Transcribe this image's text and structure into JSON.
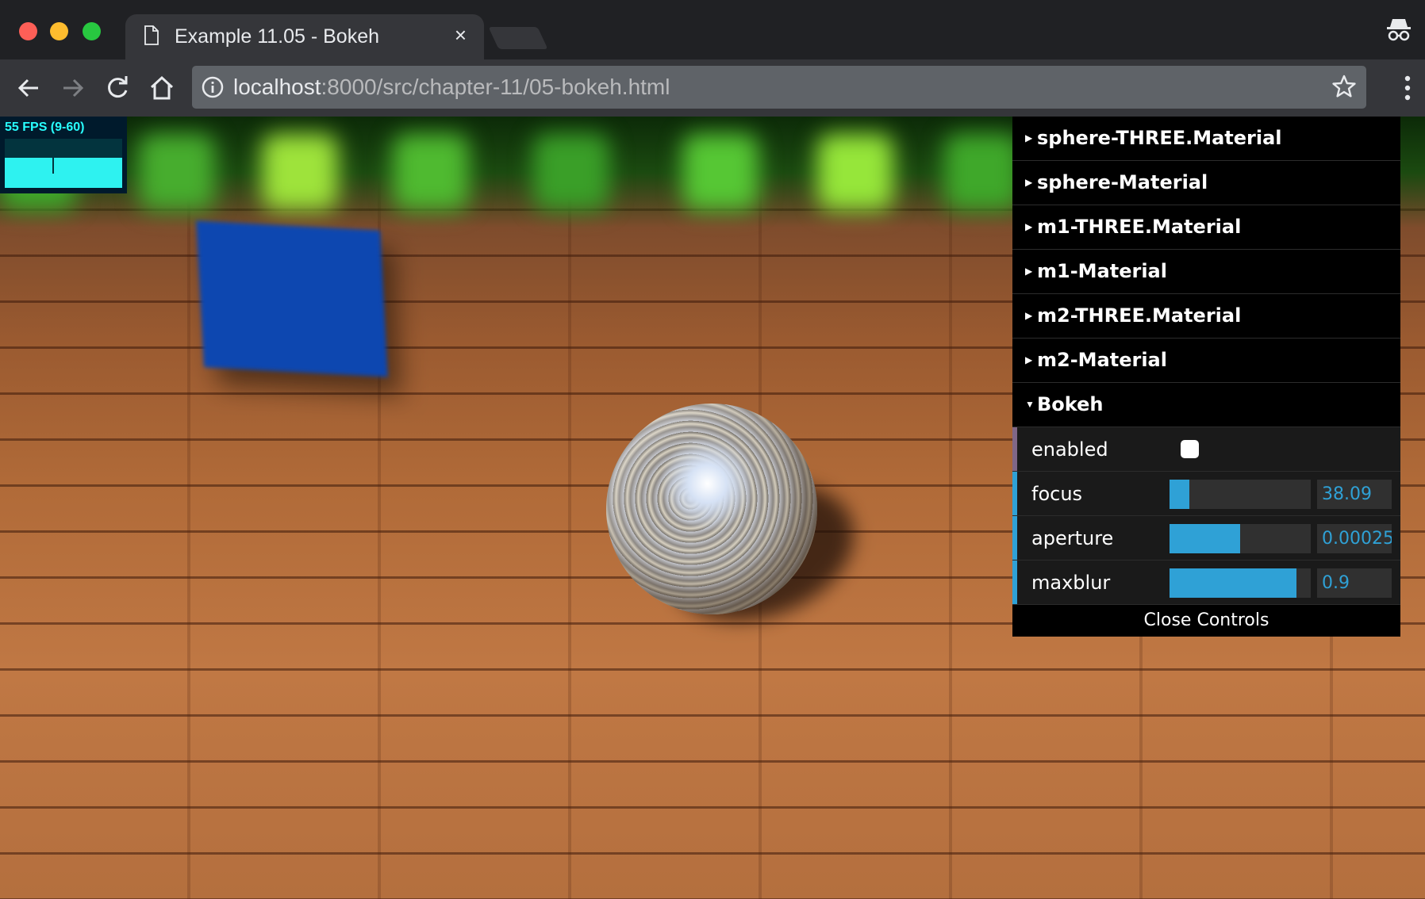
{
  "browser": {
    "tab_title": "Example 11.05 - Bokeh",
    "tab_close": "×",
    "url_host": "localhost",
    "url_path": ":8000/src/chapter-11/05-bokeh.html",
    "icons": [
      "page-icon",
      "close-icon",
      "incognito-icon",
      "back-icon",
      "forward-icon",
      "reload-icon",
      "home-icon",
      "info-icon",
      "star-icon",
      "menu-icon"
    ]
  },
  "stats": {
    "label": "55 FPS (9-60)",
    "fps": 55,
    "min": 9,
    "max": 60,
    "colors": {
      "text": "#28ffff",
      "bar": "#2ef2f0"
    }
  },
  "gui": {
    "folders": [
      {
        "label": "sphere-THREE.Material"
      },
      {
        "label": "sphere-Material"
      },
      {
        "label": "m1-THREE.Material"
      },
      {
        "label": "m1-Material"
      },
      {
        "label": "m2-THREE.Material"
      },
      {
        "label": "m2-Material"
      }
    ],
    "open_folder": {
      "label": "Bokeh"
    },
    "controls": {
      "enabled": {
        "label": "enabled",
        "checked": false
      },
      "focus": {
        "label": "focus",
        "value": "38.09",
        "fraction": 0.14
      },
      "aperture": {
        "label": "aperture",
        "value": "0.00025",
        "fraction": 0.5
      },
      "maxblur": {
        "label": "maxblur",
        "value": "0.9",
        "fraction": 0.9
      }
    },
    "close_label": "Close Controls",
    "colors": {
      "slider_fill": "#2fa1d6",
      "boolean_accent": "#806787",
      "number_accent": "#2fa1d6"
    }
  }
}
